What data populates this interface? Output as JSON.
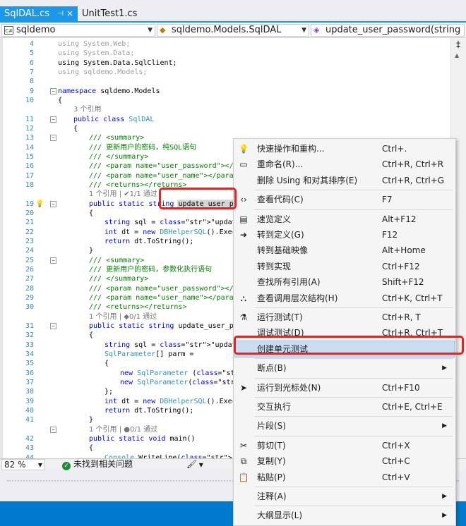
{
  "tabs": [
    {
      "label": "SqlDAL.cs",
      "pin": "⊣",
      "close": "×",
      "active": true
    },
    {
      "label": "UnitTest1.cs",
      "active": false
    }
  ],
  "nav": {
    "project": "sqldemo",
    "class": "sqldemo.Models.SqlDAL",
    "member": "update_user_password(string u"
  },
  "code_lines": [
    {
      "n": "4",
      "t": "using System.Web;"
    },
    {
      "n": "5",
      "t": "using System.Data;"
    },
    {
      "n": "6",
      "t": "using System.Data.SqlClient;"
    },
    {
      "n": "7",
      "t": "using sqldemo.Models;"
    },
    {
      "n": "8",
      "t": ""
    },
    {
      "n": "9",
      "t": "namespace sqldemo.Models"
    },
    {
      "n": "10",
      "t": "{"
    },
    {
      "n": "",
      "t": "3 个引用"
    },
    {
      "n": "11",
      "t": "public class SqlDAL"
    },
    {
      "n": "12",
      "t": "{"
    },
    {
      "n": "13",
      "t": "/// <summary>"
    },
    {
      "n": "14",
      "t": "/// 更新用户的密码，纯SQL语句"
    },
    {
      "n": "15",
      "t": "/// </summary>"
    },
    {
      "n": "16",
      "t": "/// <param name=\"user_password\"></param"
    },
    {
      "n": "17",
      "t": "/// <param name=\"user_name\"></param>"
    },
    {
      "n": "18",
      "t": "/// <returns></returns>"
    },
    {
      "n": "",
      "t": "1 个引用 | ✔1/1 通过"
    },
    {
      "n": "19",
      "t": "public static string update_user_passwo"
    },
    {
      "n": "20",
      "t": "{"
    },
    {
      "n": "21",
      "t": "string sql = \"update user_info set"
    },
    {
      "n": "22",
      "t": "int dt = new DBHelperSQL().ExecuteS"
    },
    {
      "n": "23",
      "t": "return dt.ToString();"
    },
    {
      "n": "24",
      "t": "}"
    },
    {
      "n": "25",
      "t": "/// <summary>"
    },
    {
      "n": "26",
      "t": "/// 更新用户的密码，参数化执行语句"
    },
    {
      "n": "27",
      "t": "/// </summary>"
    },
    {
      "n": "28",
      "t": "/// <param name=\"user_password\"></param"
    },
    {
      "n": "29",
      "t": "/// <param name=\"user_name\"></param>"
    },
    {
      "n": "30",
      "t": "/// <returns></returns>"
    },
    {
      "n": "",
      "t": "1 个引用 | ◆0/1 通过"
    },
    {
      "n": "31",
      "t": "public static string update_user_passwo"
    },
    {
      "n": "32",
      "t": "{"
    },
    {
      "n": "33",
      "t": "string sql = \"update user_info set"
    },
    {
      "n": "34",
      "t": "SqlParameter[] parm ="
    },
    {
      "n": "35",
      "t": "{"
    },
    {
      "n": "36",
      "t": "new SqlParameter (\"@user_name\","
    },
    {
      "n": "37",
      "t": "new SqlParameter(\"@user_passwor"
    },
    {
      "n": "38",
      "t": "};"
    },
    {
      "n": "39",
      "t": "int dt = new DBHelperSQL().ExecuteS"
    },
    {
      "n": "40",
      "t": "return dt.ToString();"
    },
    {
      "n": "41",
      "t": "}"
    },
    {
      "n": "",
      "t": "1 个引用 | ●0/1 通过"
    },
    {
      "n": "42",
      "t": "public static void main()"
    },
    {
      "n": "43",
      "t": "{"
    },
    {
      "n": "44",
      "t": "Console.WriteLine(\"你好，世界！\");"
    }
  ],
  "status": {
    "zoom": "82 %",
    "issues": "未找到相关问题"
  },
  "menu": [
    {
      "label": "快速操作和重构...",
      "shortcut": "Ctrl+.",
      "icon": "lightbulb-icon",
      "glyph": "💡"
    },
    {
      "label": "重命名(R)...",
      "shortcut": "Ctrl+R, Ctrl+R",
      "icon": "rename-icon",
      "glyph": "▭"
    },
    {
      "label": "删除 Using 和对其排序(E)",
      "shortcut": "Ctrl+R, Ctrl+G"
    },
    {
      "sep": true
    },
    {
      "label": "查看代码(C)",
      "shortcut": "F7",
      "icon": "view-code-icon",
      "glyph": "‹›"
    },
    {
      "sep": true
    },
    {
      "label": "速览定义",
      "shortcut": "Alt+F12",
      "icon": "peek-definition-icon",
      "glyph": "▤"
    },
    {
      "label": "转到定义(G)",
      "shortcut": "F12",
      "icon": "go-to-definition-icon",
      "glyph": "➜"
    },
    {
      "label": "转到基础映像",
      "shortcut": "Alt+Home"
    },
    {
      "label": "转到实现",
      "shortcut": "Ctrl+F12"
    },
    {
      "label": "查找所有引用(A)",
      "shortcut": "Shift+F12"
    },
    {
      "label": "查看调用层次结构(H)",
      "shortcut": "Ctrl+K, Ctrl+T",
      "icon": "call-hierarchy-icon",
      "glyph": "⛬"
    },
    {
      "sep": true
    },
    {
      "label": "运行测试(T)",
      "shortcut": "Ctrl+R, T",
      "icon": "run-test-icon",
      "glyph": "⚗"
    },
    {
      "label": "调试测试(D)",
      "shortcut": "Ctrl+R, Ctrl+T"
    },
    {
      "label": "创建单元测试",
      "shortcut": "",
      "selected": true
    },
    {
      "sep": true
    },
    {
      "label": "断点(B)",
      "shortcut": "",
      "submenu": true
    },
    {
      "sep": true
    },
    {
      "label": "运行到光标处(N)",
      "shortcut": "Ctrl+F10",
      "icon": "run-to-cursor-icon",
      "glyph": "➤"
    },
    {
      "sep": true
    },
    {
      "label": "交互执行",
      "shortcut": "Ctrl+E, Ctrl+E"
    },
    {
      "sep": true
    },
    {
      "label": "片段(S)",
      "shortcut": "",
      "submenu": true
    },
    {
      "sep": true
    },
    {
      "label": "剪切(T)",
      "shortcut": "Ctrl+X",
      "icon": "cut-icon",
      "glyph": "✂"
    },
    {
      "label": "复制(Y)",
      "shortcut": "Ctrl+C",
      "icon": "copy-icon",
      "glyph": "⧉"
    },
    {
      "label": "粘贴(P)",
      "shortcut": "Ctrl+V",
      "icon": "paste-icon",
      "glyph": "📋"
    },
    {
      "sep": true
    },
    {
      "label": "注释(A)",
      "shortcut": "",
      "submenu": true
    },
    {
      "sep": true
    },
    {
      "label": "大纲显示(L)",
      "shortcut": "",
      "submenu": true
    }
  ]
}
